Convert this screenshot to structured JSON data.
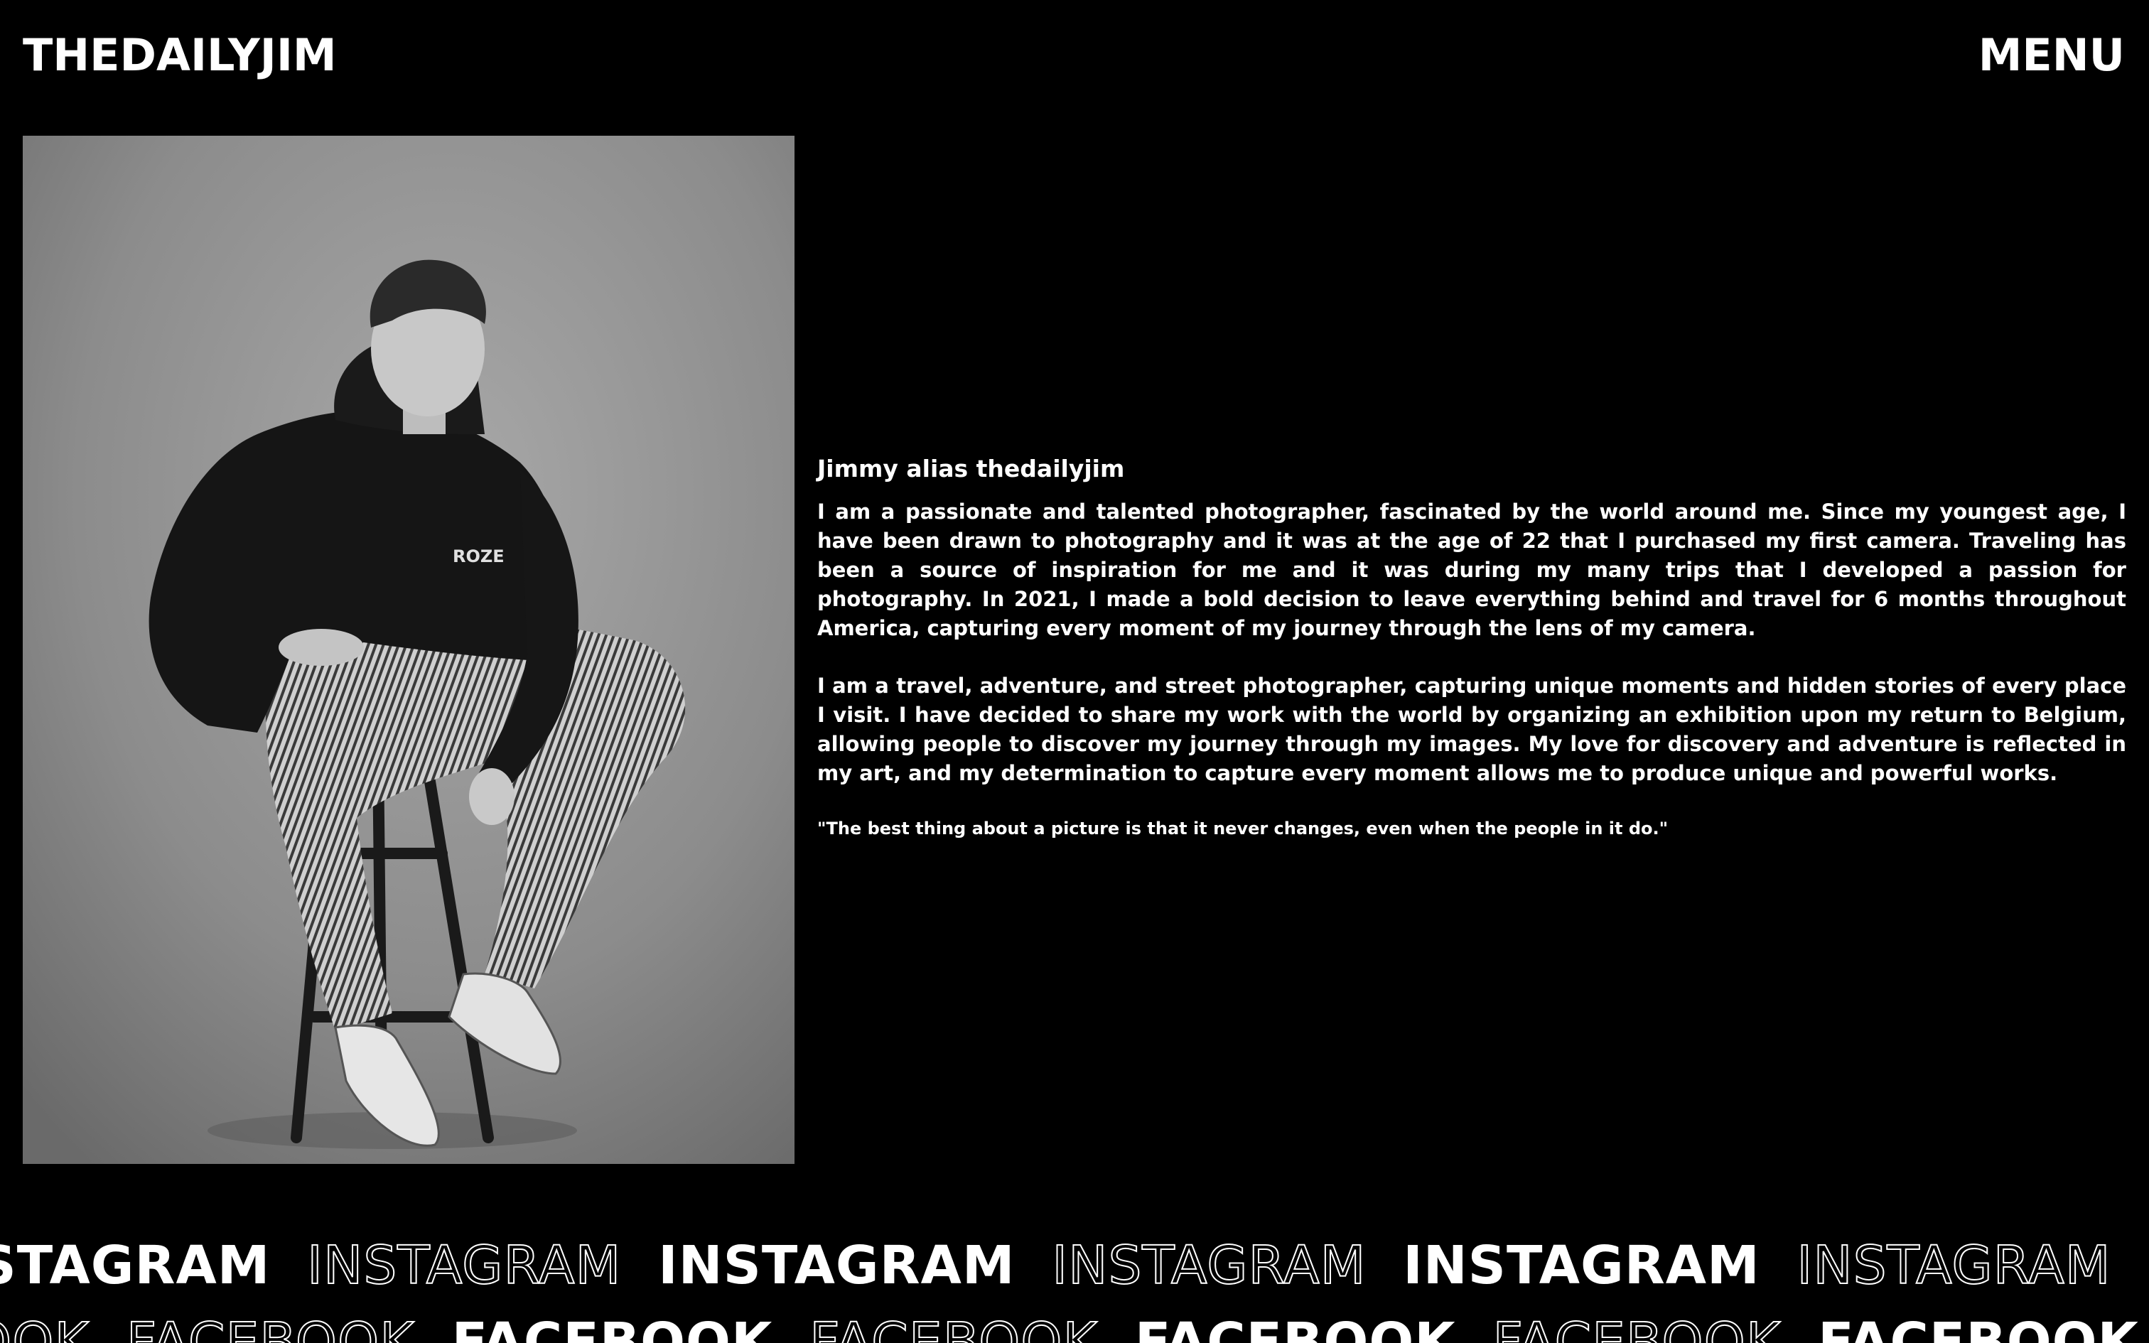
{
  "header": {
    "logo": "THEDAILYJIM",
    "menu_label": "MENU"
  },
  "photo": {
    "description_icon": "portrait-photo"
  },
  "bio": {
    "title": "Jimmy alias thedailyjim",
    "paragraphs": [
      "I am a passionate and talented photographer, fascinated by the world around me. Since my youngest age, I have been drawn to photography and it was at the age of 22 that I purchased my first camera. Traveling has been a source of inspiration for me and it was during my many trips that I developed a passion for photography. In 2021, I made a bold decision to leave everything behind and travel for 6 months throughout America, capturing every moment of my journey through the lens of my camera.",
      "I am a travel, adventure, and street photographer, capturing unique moments and hidden stories of every place I visit. I have decided to share my work with the world by organizing an exhibition upon my return to Belgium, allowing people to discover my journey through my images. My love for discovery and adventure is reflected in my art, and my determination to capture every moment allows me to produce unique and powerful works."
    ],
    "quote": "\"The best thing about a picture is that it never changes, even when the people in it do.\""
  },
  "social": {
    "instagram": "INSTAGRAM",
    "facebook": "FACEBOOK"
  },
  "colors": {
    "background": "#000000",
    "text": "#ffffff"
  }
}
